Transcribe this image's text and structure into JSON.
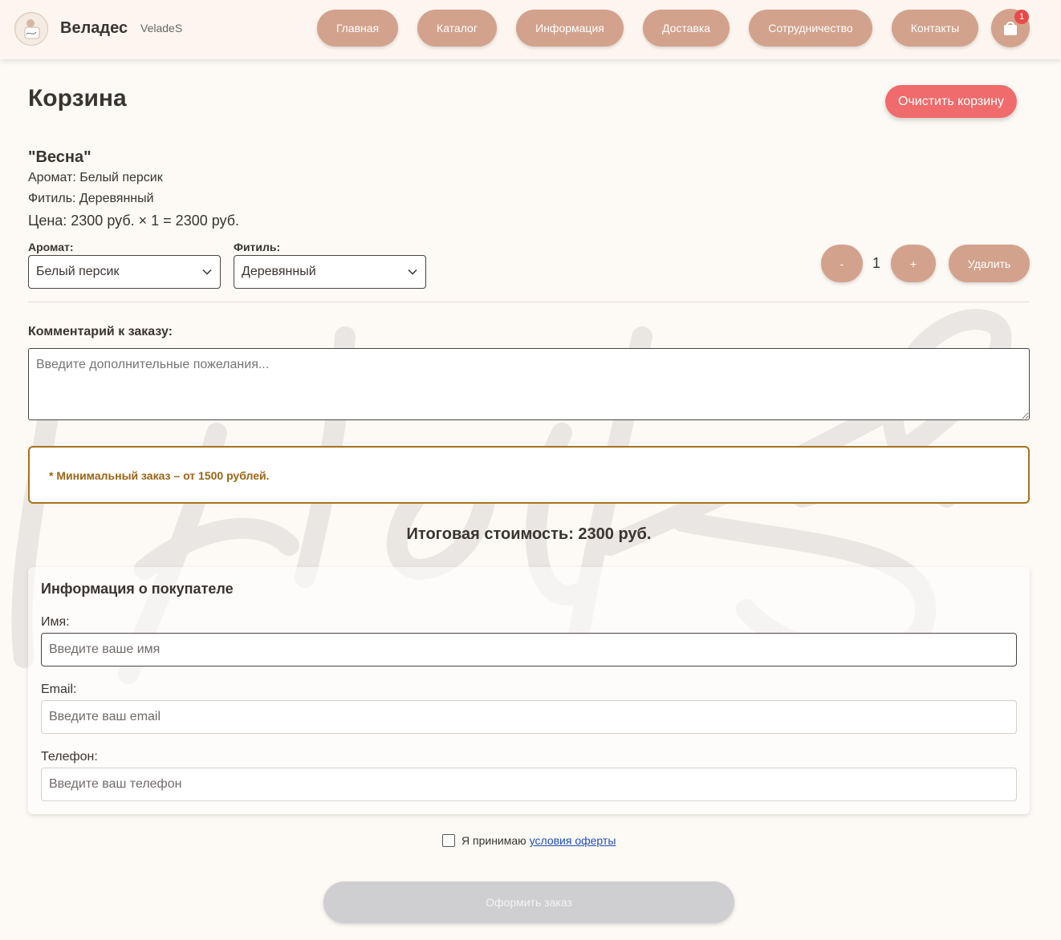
{
  "header": {
    "brand": "Веладес",
    "brand_sub": "VeladeS",
    "nav": [
      "Главная",
      "Каталог",
      "Информация",
      "Доставка",
      "Сотрудничество",
      "Контакты"
    ],
    "cart_count": "1"
  },
  "cart": {
    "title": "Корзина",
    "clear_label": "Очистить корзину",
    "item": {
      "name": "\"Весна\"",
      "aroma_line": "Аромат: Белый персик",
      "wick_line": "Фитиль: Деревянный",
      "price_line": "Цена: 2300 руб. × 1 = 2300 руб.",
      "aroma_label": "Аромат:",
      "aroma_value": "Белый персик",
      "wick_label": "Фитиль:",
      "wick_value": "Деревянный",
      "minus_label": "-",
      "quantity": "1",
      "plus_label": "+",
      "delete_label": "Удалить"
    },
    "comment_label": "Комментарий к заказу:",
    "comment_placeholder": "Введите дополнительные пожелания...",
    "min_order_note": "* Минимальный заказ – от 1500 рублей.",
    "total": "Итоговая стоимость: 2300 руб."
  },
  "buyer": {
    "title": "Информация о покупателе",
    "name_label": "Имя:",
    "name_placeholder": "Введите ваше имя",
    "email_label": "Email:",
    "email_placeholder": "Введите ваш email",
    "phone_label": "Телефон:",
    "phone_placeholder": "Введите ваш телефон"
  },
  "offer": {
    "text": "Я принимаю",
    "link": "условия оферты"
  },
  "submit_label": "Оформить заказ",
  "colors": {
    "accent": "#d3a28c",
    "danger": "#f06b6b",
    "warning": "#a8721e",
    "background": "#fdf9f5"
  }
}
